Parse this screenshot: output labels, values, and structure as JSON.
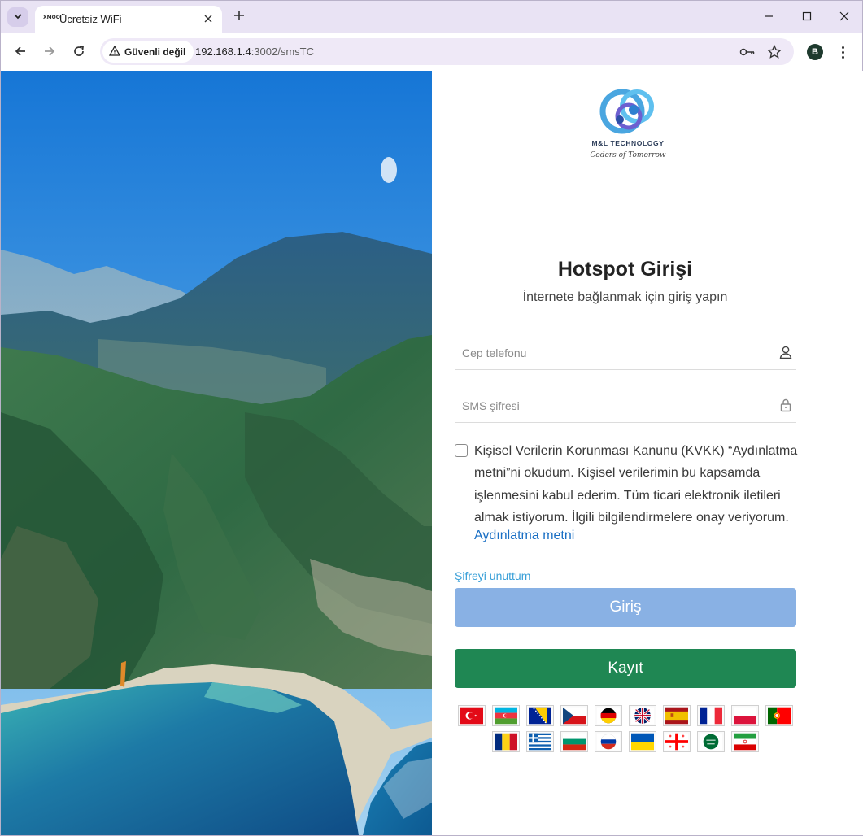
{
  "browser": {
    "tab_title": "Ücretsiz WiFi",
    "favicon_text": "XMOO",
    "security_label": "Güvenli değil",
    "url_host": "192.168.1.4",
    "url_path": ":3002/smsTC",
    "profile_initial": "B"
  },
  "branding": {
    "company": "M&L TECHNOLOGY",
    "tagline": "Coders of Tomorrow"
  },
  "login": {
    "title": "Hotspot Girişi",
    "subtitle": "İnternete bağlanmak için giriş yapın",
    "phone_placeholder": "Cep telefonu",
    "sms_placeholder": "SMS şifresi",
    "consent_text": "Kişisel Verilerin Korunması Kanunu (KVKK) “Aydınlatma metni”ni okudum. Kişisel verilerimin bu kapsamda işlenmesini kabul ederim. Tüm ticari elektronik iletileri almak istiyorum. İlgili bilgilendirmelere onay veriyorum.",
    "consent_link": "Aydınlatma metni",
    "consent_checked": false,
    "forgot_label": "Şifreyi unuttum",
    "login_label": "Giriş",
    "register_label": "Kayıt"
  },
  "colors": {
    "login_button": "#89b1e4",
    "register_button": "#1f8753",
    "link": "#1a6fc4",
    "forgot_link": "#3aa0d8"
  },
  "languages": {
    "row1": [
      "turkey-flag",
      "azerbaijan-flag",
      "bosnia-flag",
      "czech-flag",
      "germany-flag",
      "uk-flag",
      "spain-flag",
      "france-flag",
      "poland-flag",
      "portugal-flag"
    ],
    "row2": [
      "romania-flag",
      "greece-flag",
      "bulgaria-flag",
      "russia-flag",
      "ukraine-flag",
      "georgia-flag",
      "saudi-arabia-flag",
      "iran-flag"
    ]
  }
}
